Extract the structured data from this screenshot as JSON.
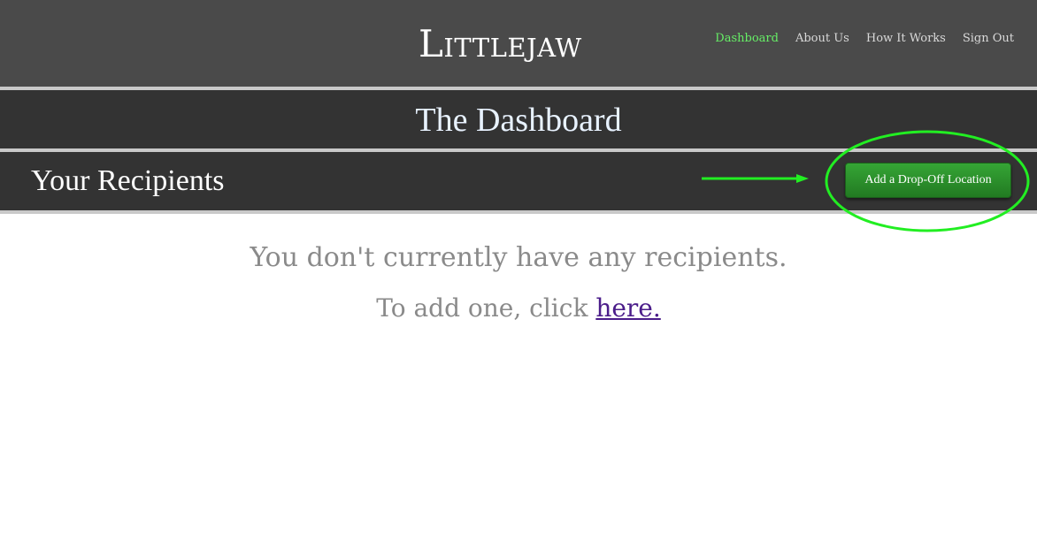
{
  "header": {
    "brand": "Littlejaw",
    "nav": [
      {
        "label": "Dashboard",
        "active": true
      },
      {
        "label": "About Us",
        "active": false
      },
      {
        "label": "How It Works",
        "active": false
      },
      {
        "label": "Sign Out",
        "active": false
      }
    ]
  },
  "dashboard": {
    "title": "The Dashboard"
  },
  "recipients": {
    "title": "Your Recipients",
    "add_button_label": "Add a Drop-Off Location"
  },
  "content": {
    "empty_message": "You don't currently have any recipients.",
    "hint_prefix": "To add one, click ",
    "hint_link": "here."
  },
  "colors": {
    "topbar": "#4a4a4a",
    "band": "#333333",
    "separator": "#c9c9c9",
    "active_nav": "#66ee66",
    "button_green": "#2e8f2e",
    "annotation_green": "#22ee22",
    "link": "#4b1d8a"
  },
  "icons": {
    "annotation": "annotation-arrow-icon"
  }
}
